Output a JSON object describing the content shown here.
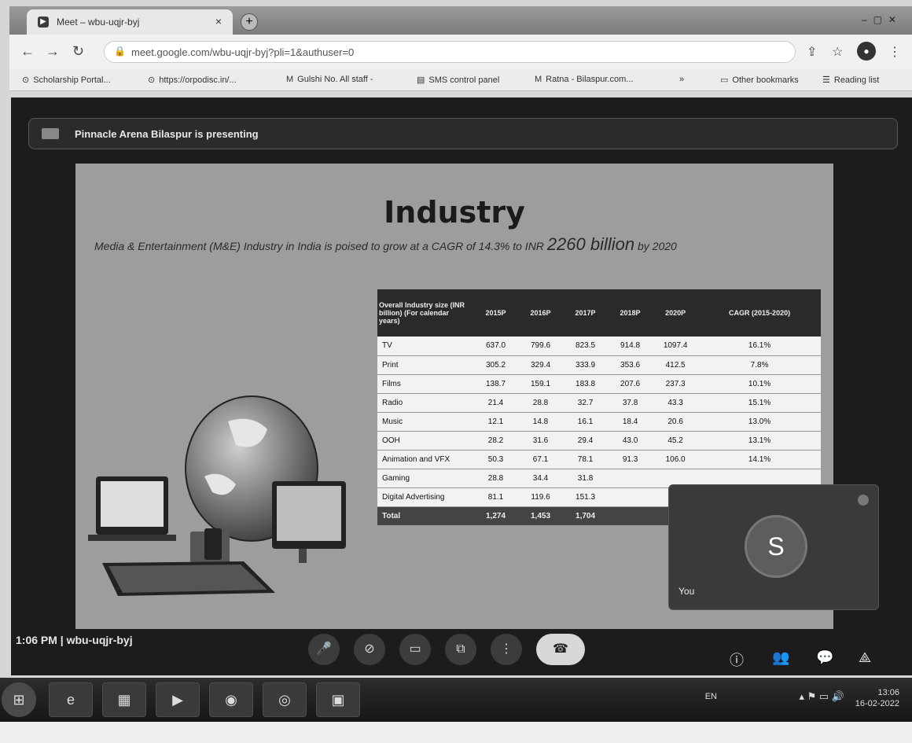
{
  "browser": {
    "tab_title": "Meet – wbu-uqjr-byj",
    "new_tab_glyph": "+",
    "url": "meet.google.com/wbu-uqjr-byj?pli=1&authuser=0",
    "bookmarks": [
      {
        "label": "Scholarship Portal...",
        "icon": "globe-icon"
      },
      {
        "label": "https://orpodisc.in/...",
        "icon": "globe-icon"
      },
      {
        "label": "Gulshi No. All staff -",
        "icon": "gmail-icon"
      },
      {
        "label": "SMS control panel",
        "icon": "sms-icon"
      },
      {
        "label": "Ratna - Bilaspur.com...",
        "icon": "gmail-icon"
      },
      {
        "label": "»",
        "icon": "more-icon"
      },
      {
        "label": "Other bookmarks",
        "icon": "folder-icon"
      },
      {
        "label": "Reading list",
        "icon": "reading-list-icon"
      }
    ]
  },
  "meet": {
    "presenting_text": "Pinnacle Arena Bilaspur is presenting",
    "time_code": "1:06 PM  |  wbu-uqjr-byj",
    "self_tile": {
      "label": "You",
      "initial": "S"
    }
  },
  "slide": {
    "title": "Industry",
    "subtitle_a": "Media & Entertainment (M&E) Industry in India is poised to grow at a CAGR of 14.3% to INR",
    "subtitle_big": "2260 billion",
    "subtitle_b": "by 2020",
    "table": {
      "headers": [
        "Overall Industry size (INR billion) (For calendar years)",
        "2015P",
        "2016P",
        "2017P",
        "2018P",
        "2020P",
        "CAGR (2015-2020)"
      ],
      "rows": [
        [
          "TV",
          "637.0",
          "799.6",
          "823.5",
          "914.8",
          "1097.4",
          "16.1%"
        ],
        [
          "Print",
          "305.2",
          "329.4",
          "333.9",
          "353.6",
          "412.5",
          "7.8%"
        ],
        [
          "Films",
          "138.7",
          "159.1",
          "183.8",
          "207.6",
          "237.3",
          "10.1%"
        ],
        [
          "Radio",
          "21.4",
          "28.8",
          "32.7",
          "37.8",
          "43.3",
          "15.1%"
        ],
        [
          "Music",
          "12.1",
          "14.8",
          "16.1",
          "18.4",
          "20.6",
          "13.0%"
        ],
        [
          "OOH",
          "28.2",
          "31.6",
          "29.4",
          "43.0",
          "45.2",
          "13.1%"
        ],
        [
          "Animation and VFX",
          "50.3",
          "67.1",
          "78.1",
          "91.3",
          "106.0",
          "14.1%"
        ],
        [
          "Gaming",
          "28.8",
          "34.4",
          "31.8",
          "",
          "",
          ""
        ],
        [
          "Digital Advertising",
          "81.1",
          "119.6",
          "151.3",
          "",
          "",
          ""
        ]
      ],
      "total": [
        "Total",
        "1,274",
        "1,453",
        "1,704",
        "",
        "",
        ""
      ]
    }
  },
  "taskbar": {
    "lang": "EN",
    "time": "13:06",
    "date": "16-02-2022"
  },
  "colors": {
    "slide_bg": "#9d9d9d",
    "meet_bg": "#1c1c1c",
    "end_call": "#d8d8d8"
  }
}
